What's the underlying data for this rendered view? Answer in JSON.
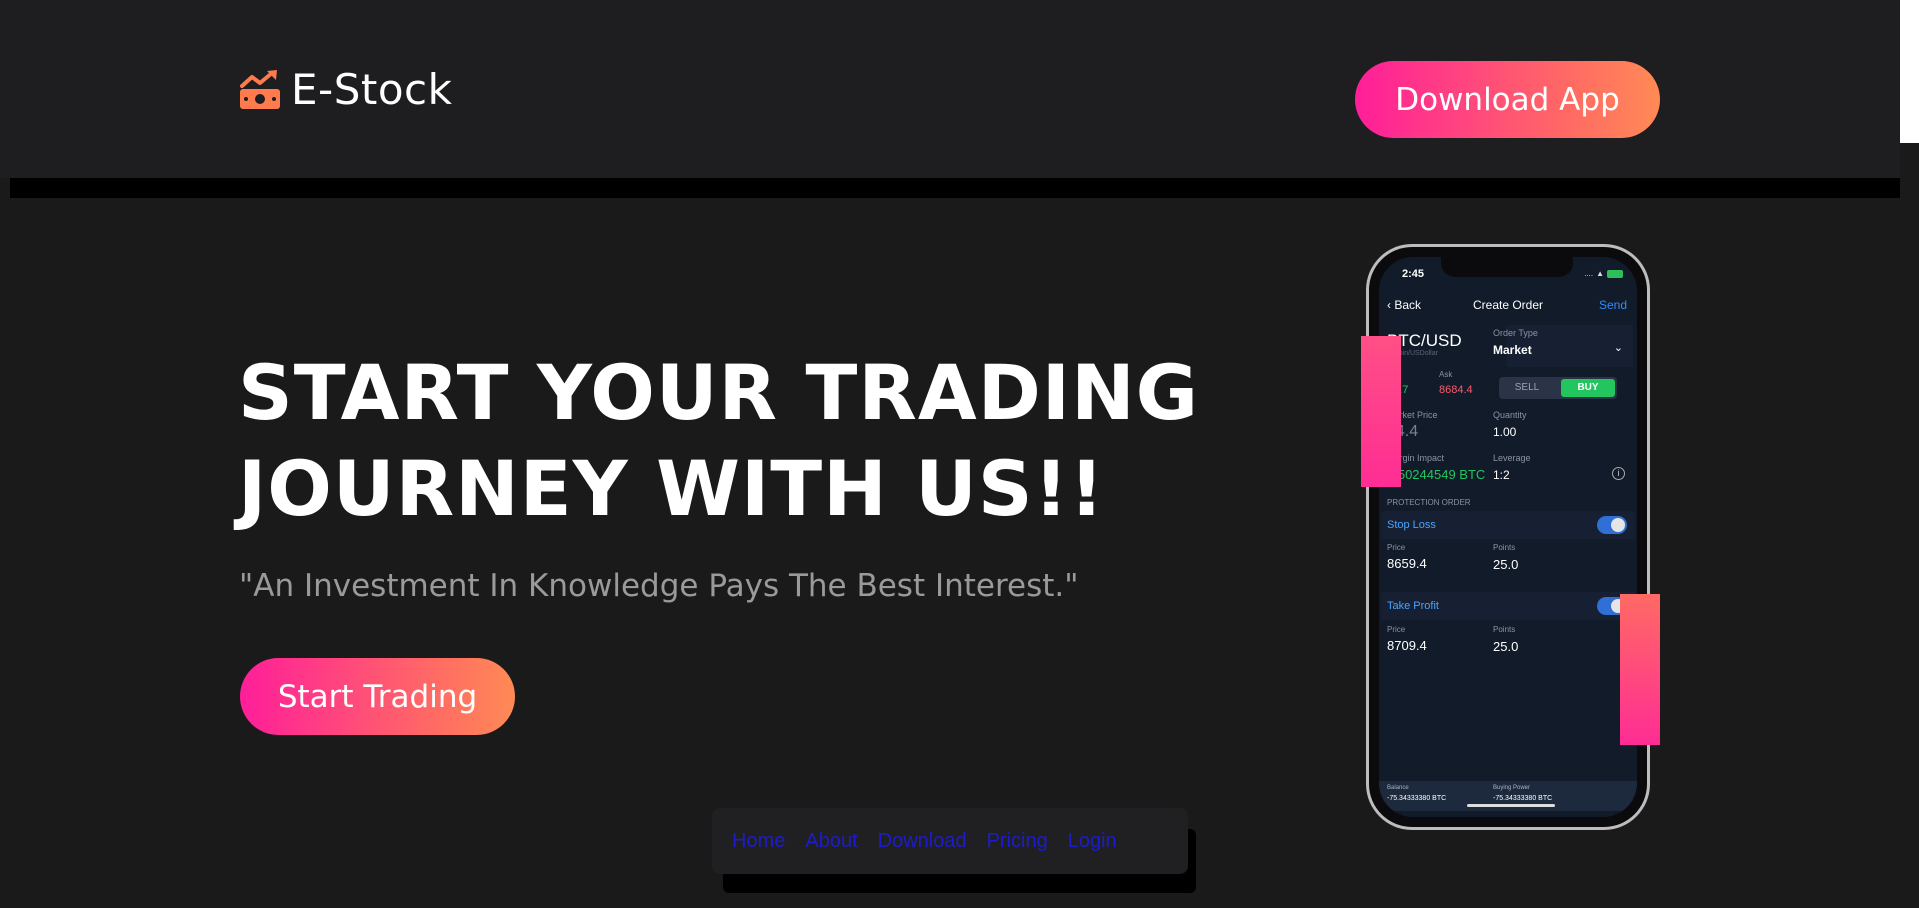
{
  "header": {
    "logo_text": "E-Stock",
    "download_label": "Download App"
  },
  "hero": {
    "title_line1": "START YOUR TRADING",
    "title_line2": "JOURNEY WITH US!!",
    "quote": "\"An Investment In Knowledge Pays The Best Interest.\"",
    "cta_label": "Start Trading"
  },
  "nav": {
    "items": [
      "Home",
      "About",
      "Download",
      "Pricing",
      "Login"
    ]
  },
  "phone": {
    "status_time": "2:45",
    "back_label": "Back",
    "title": "Create Order",
    "send_label": "Send",
    "pair": "BTC/USD",
    "pair_sub": "Bitcoin/USDollar",
    "order_type_label": "Order Type",
    "order_type_value": "Market",
    "bid": "63.7",
    "ask_label": "Ask",
    "ask": "8684.4",
    "sell_label": "SELL",
    "buy_label": "BUY",
    "market_price_label": "Market Price",
    "market_price": "84.4",
    "quantity_label": "Quantity",
    "quantity": "1.00",
    "margin_impact_label": "Margin Impact",
    "margin_impact": "0.50244549 BTC",
    "leverage_label": "Leverage",
    "leverage": "1:2",
    "protection_label": "PROTECTION ORDER",
    "stop_loss_label": "Stop Loss",
    "price_label": "Price",
    "points_label": "Points",
    "sl_price": "8659.4",
    "sl_points": "25.0",
    "take_profit_label": "Take Profit",
    "tp_price": "8709.4",
    "tp_points": "25.0",
    "balance_label": "Balance",
    "balance_value": "-75.34333380 BTC",
    "buying_power_label": "Buying Power",
    "buying_power_value": "-75.34333380 BTC"
  },
  "colors": {
    "accent_start": "#ff1e9a",
    "accent_end": "#ff8a55",
    "background": "#1a1a1b",
    "nav_link": "#1c1ccc",
    "buy_green": "#22c55e"
  }
}
